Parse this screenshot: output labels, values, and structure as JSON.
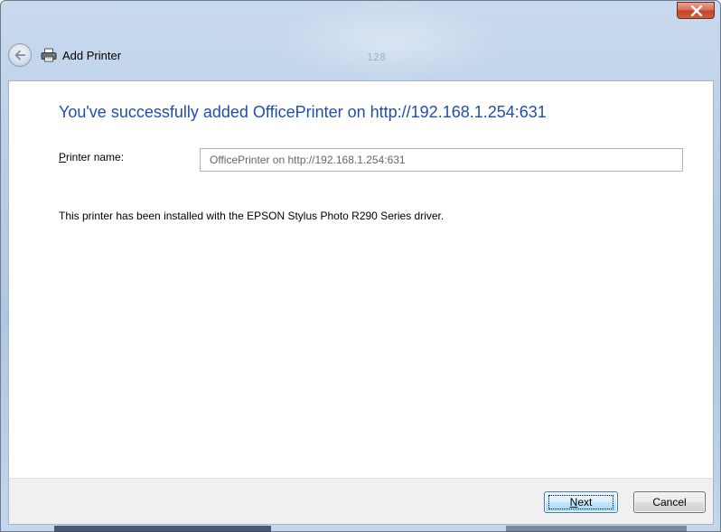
{
  "window": {
    "title": "Add Printer",
    "background_glyph": "128",
    "close_symbol": "x"
  },
  "icons": {
    "back": "back-arrow-icon",
    "printer": "printer-icon",
    "close": "close-icon"
  },
  "content": {
    "headline": "You've successfully added OfficePrinter on http://192.168.1.254:631",
    "printer_name_label_mnemonic": "P",
    "printer_name_label_rest": "rinter name:",
    "printer_name_value": "OfficePrinter on http://192.168.1.254:631",
    "driver_message": "This printer has been installed with the EPSON Stylus Photo R290 Series driver."
  },
  "footer": {
    "next_mnemonic": "N",
    "next_rest": "ext",
    "cancel_label": "Cancel"
  },
  "colors": {
    "headline": "#1f4fa8",
    "close_button": "#c4412a",
    "default_button_border": "#3c7fb1"
  }
}
